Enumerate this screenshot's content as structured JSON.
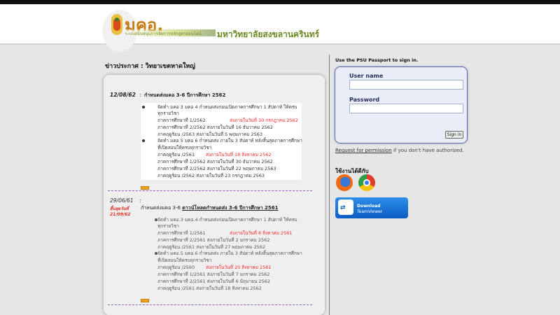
{
  "header": {
    "logo_title": "มคอ.",
    "logo_subtitle": "ระบบสนับสนุนการจัดการหลักสูตรออนไลน์",
    "university": "มหาวิทยาลัยสงขลานครินทร์"
  },
  "news": {
    "heading": "ข่าวประกาศ : วิทยาเขตหาดใหญ่",
    "entries": [
      {
        "date": "12/08/62",
        "colon": ":",
        "title": "กำหนดส่งมคอ 3-6 ปีการศึกษา 2562",
        "lines": [
          "จัดทำ มคอ 3 มคอ 4 กำหนดส่งก่อนเปิดภาคการศึกษา  1 สัปดาห์  ให้ครบ",
          "ทุกรายวิชา",
          "ภาคการศึกษาที่ 1/2562",
          "ส่งภายในวันที่ 30 กรกฎาคม 2562",
          "ภาคการศึกษาที่ 2/2562   ส่งภายในวันที่ 16 ธันวาคม  2562",
          "ภาคฤดูร้อน /2563   ส่งภายในวันที่  5 พฤษภาคม  2563",
          "จัดทำ มคอ 5 มคอ 6 กำหนดส่ง ภายใน 3 สัปดาห์  หลังสิ้นสุดภาคการศึกษา",
          "ที่เปิดสอนให้ครบทุกรายวิชา",
          "ภาคฤดูร้อน /2561",
          "ส่งภายในวันที่ 18 สิงหาคม 2562",
          "ภาคการศึกษาที่ 1/2562    ส่งภายในวันที่  30  ธันวาคม  2562",
          "ภาคการศึกษาที่ 2/2562    ส่งภายในวันที่  22  พฤษภาคม 2563",
          "ภาคฤดูร้อน /2562            ส่งภายในวันที่  23  กรกฎาคม 2563"
        ],
        "more": "more"
      },
      {
        "date": "29/06/61",
        "status": "สิ้นสุดวันที่",
        "end_date": "21/09/62",
        "colon": ":",
        "title_prefix": "กำหนดส่งมคอ 3-6 ",
        "title_link": "ดาวน์โหลดกำหนดส่ง 3-6 ปีการศึกษา 2561",
        "lines": [
          "จัดทำ มคอ.3 มคอ.4 กำหนดส่งก่อนเปิดภาคการศึกษา  1 สัปดาห์  ให้ครบ",
          "ทุกรายวิชา",
          "ภาคการศึกษาที่ 1/2561",
          "ส่งภายในวันที่ 8 สิงหาคม 2561",
          "ภาคการศึกษาที่ 2/2561   ส่งภายในวันที่ 2 มกราคม 2562",
          "ภาคฤดูร้อน /2561   ส่งภายในวันที่ 27 พฤษภาคม 2562",
          "จัดทำ มคอ.5 มคอ.6 กำหนดส่ง ภายใน 3 สัปดาห์  หลังสิ้นสุดภาคการศึกษา",
          "ที่เปิดสอนให้ครบทุกรายวิชา",
          "ภาคฤดูร้อน /2560",
          "ส่งภายในวันที่ 20 สิงหาคม 2561",
          "ภาคการศึกษาที่ 1/2561   ส่งภายในวันที่ 7 มกราคม 2562",
          "ภาคการศึกษาที่ 2/2561   ส่งภายในวันที่ 6 มิถุนายน 2562",
          "ภาคฤดูร้อน /2561            ส่งภายในวันที่ 18 สิงหาคม 2562"
        ],
        "more": "more"
      }
    ]
  },
  "login": {
    "note": "Use the PSU Passport to sign in.",
    "username_label": "User name",
    "password_label": "Password",
    "signin_label": "Sign in",
    "request_link": "Request for permission",
    "request_suffix": " if you don't have authorized."
  },
  "browsers": {
    "heading": "ใช้งานได้ดีกับ",
    "items": [
      "firefox-icon",
      "chrome-icon"
    ]
  },
  "teamviewer": {
    "line1": "Download",
    "line2": "TeamViewer"
  },
  "colors": {
    "accent_red": "#ff2a2a",
    "logo_orange": "#c47a10",
    "logo_green": "#6a8a22",
    "login_border": "#5a6aa8",
    "separator_purple": "#9b59d0"
  }
}
